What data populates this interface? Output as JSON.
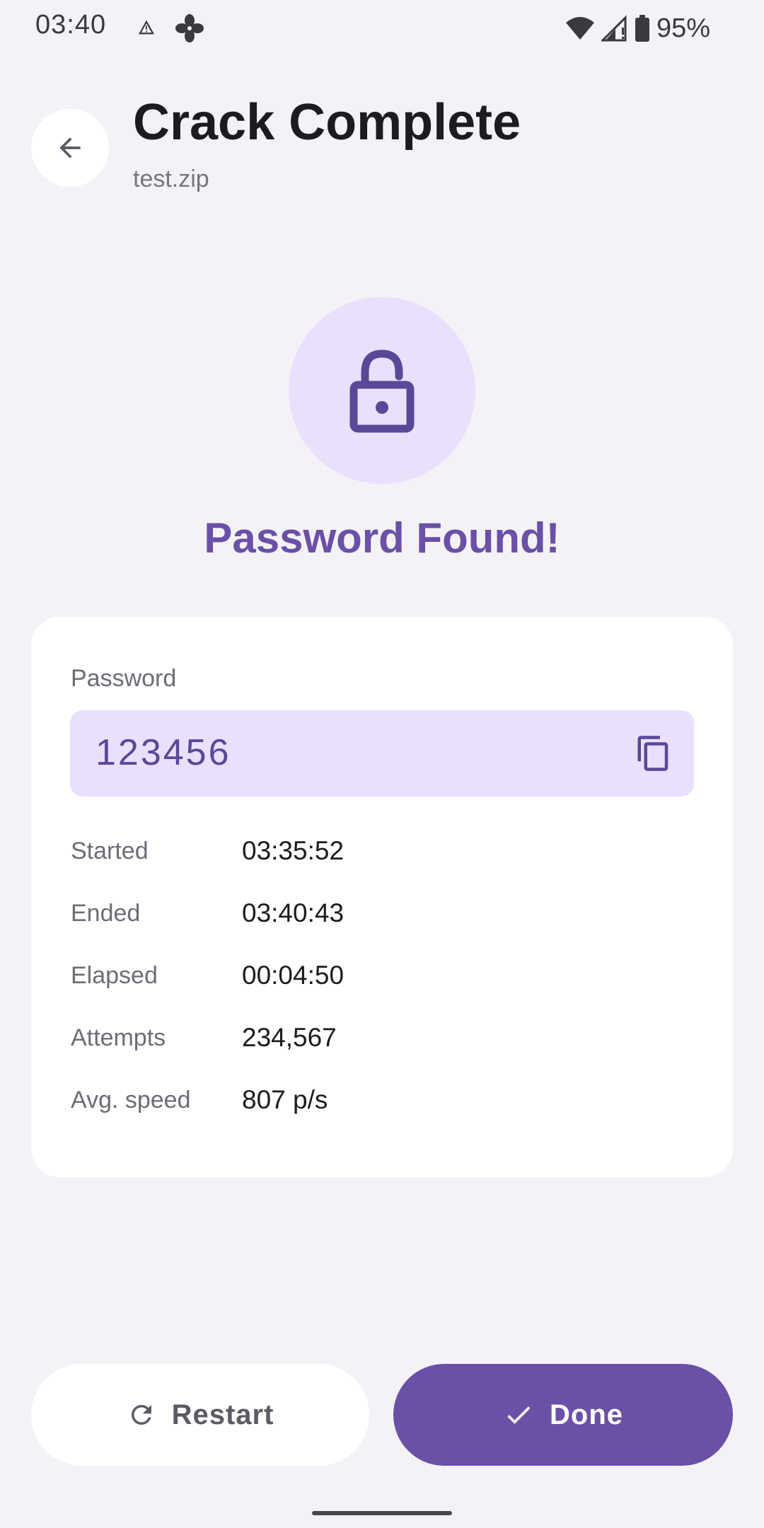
{
  "status_bar": {
    "time": "03:40",
    "battery_percent": "95%",
    "icons": [
      "warning-icon",
      "fan-icon",
      "wifi-icon",
      "signal-icon",
      "battery-icon"
    ]
  },
  "header": {
    "title": "Crack Complete",
    "subtitle": "test.zip",
    "back_icon": "arrow-back-icon"
  },
  "result": {
    "icon": "lock-open-icon",
    "headline": "Password Found!",
    "password_label": "Password",
    "password_value": "123456",
    "copy_icon": "copy-icon"
  },
  "stats": [
    {
      "label": "Started",
      "value": "03:35:52"
    },
    {
      "label": "Ended",
      "value": "03:40:43"
    },
    {
      "label": "Elapsed",
      "value": "00:04:50"
    },
    {
      "label": "Attempts",
      "value": "234,567"
    },
    {
      "label": "Avg. speed",
      "value": "807 p/s"
    }
  ],
  "actions": {
    "restart_label": "Restart",
    "restart_icon": "refresh-icon",
    "done_label": "Done",
    "done_icon": "check-icon"
  },
  "colors": {
    "background": "#f4f2f7",
    "accent": "#6a50a7",
    "accent_container": "#e8e0fd",
    "surface": "#ffffff"
  }
}
